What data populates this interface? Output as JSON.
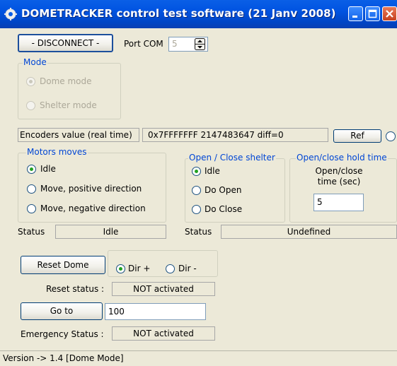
{
  "window": {
    "title": "DOMETRACKER control test software (21 Janv 2008)"
  },
  "connection": {
    "disconnect_label": "- DISCONNECT -",
    "port_label": "Port COM",
    "port_value": "5"
  },
  "mode": {
    "legend": "Mode",
    "dome_label": "Dome mode",
    "shelter_label": "Shelter mode"
  },
  "encoders": {
    "label": "Encoders value (real time)",
    "value": "0x7FFFFFFF  2147483647  diff=0",
    "ref_label": "Ref"
  },
  "motors": {
    "legend": "Motors moves",
    "options": [
      "Idle",
      "Move, positive direction",
      "Move, negative direction"
    ],
    "status_label": "Status",
    "status_value": "Idle"
  },
  "shelter": {
    "legend": "Open / Close shelter",
    "options": [
      "Idle",
      "Do Open",
      "Do Close"
    ],
    "status_label": "Status",
    "status_value": "Undefined"
  },
  "hold_time": {
    "legend": "Open/close hold time",
    "label": "Open/close\ntime (sec)",
    "value": "5"
  },
  "reset": {
    "button_label": "Reset Dome",
    "dir_plus": "Dir +",
    "dir_minus": "Dir -",
    "status_label": "Reset status :",
    "status_value": "NOT activated"
  },
  "goto": {
    "button_label": "Go to",
    "value": "100"
  },
  "emergency": {
    "label": "Emergency Status :",
    "value": "NOT activated"
  },
  "statusbar": {
    "text": "Version -> 1.4 [Dome Mode]"
  }
}
